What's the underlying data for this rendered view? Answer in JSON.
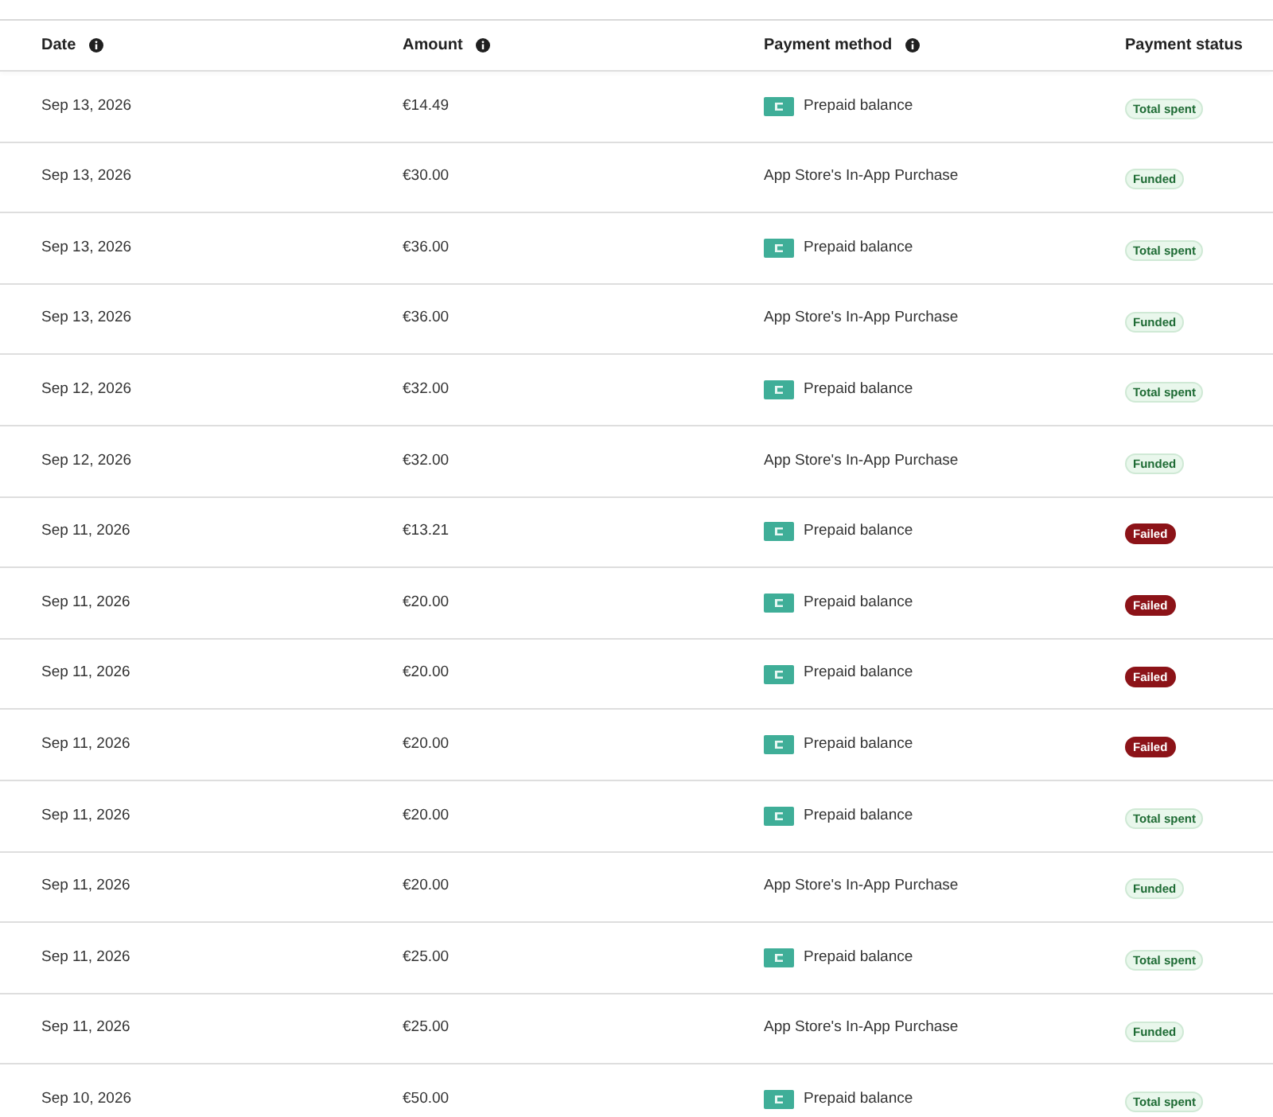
{
  "columns": [
    {
      "label": "Date",
      "info": true
    },
    {
      "label": "Amount",
      "info": true
    },
    {
      "label": "Payment method",
      "info": true
    },
    {
      "label": "Payment status",
      "info": false
    }
  ],
  "rows": [
    {
      "date": "Sep 13, 2026",
      "amount": "€14.49",
      "method": {
        "kind": "prepaid",
        "label": "Prepaid balance"
      },
      "status": {
        "kind": "total_spent",
        "label": "Total spent"
      }
    },
    {
      "date": "Sep 13, 2026",
      "amount": "€30.00",
      "method": {
        "kind": "app_store",
        "label": "App Store's In-App Purchase"
      },
      "status": {
        "kind": "funded",
        "label": "Funded"
      }
    },
    {
      "date": "Sep 13, 2026",
      "amount": "€36.00",
      "method": {
        "kind": "prepaid",
        "label": "Prepaid balance"
      },
      "status": {
        "kind": "total_spent",
        "label": "Total spent"
      }
    },
    {
      "date": "Sep 13, 2026",
      "amount": "€36.00",
      "method": {
        "kind": "app_store",
        "label": "App Store's In-App Purchase"
      },
      "status": {
        "kind": "funded",
        "label": "Funded"
      }
    },
    {
      "date": "Sep 12, 2026",
      "amount": "€32.00",
      "method": {
        "kind": "prepaid",
        "label": "Prepaid balance"
      },
      "status": {
        "kind": "total_spent",
        "label": "Total spent"
      }
    },
    {
      "date": "Sep 12, 2026",
      "amount": "€32.00",
      "method": {
        "kind": "app_store",
        "label": "App Store's In-App Purchase"
      },
      "status": {
        "kind": "funded",
        "label": "Funded"
      }
    },
    {
      "date": "Sep 11, 2026",
      "amount": "€13.21",
      "method": {
        "kind": "prepaid",
        "label": "Prepaid balance"
      },
      "status": {
        "kind": "failed",
        "label": "Failed"
      }
    },
    {
      "date": "Sep 11, 2026",
      "amount": "€20.00",
      "method": {
        "kind": "prepaid",
        "label": "Prepaid balance"
      },
      "status": {
        "kind": "failed",
        "label": "Failed"
      }
    },
    {
      "date": "Sep 11, 2026",
      "amount": "€20.00",
      "method": {
        "kind": "prepaid",
        "label": "Prepaid balance"
      },
      "status": {
        "kind": "failed",
        "label": "Failed"
      }
    },
    {
      "date": "Sep 11, 2026",
      "amount": "€20.00",
      "method": {
        "kind": "prepaid",
        "label": "Prepaid balance"
      },
      "status": {
        "kind": "failed",
        "label": "Failed"
      }
    },
    {
      "date": "Sep 11, 2026",
      "amount": "€20.00",
      "method": {
        "kind": "prepaid",
        "label": "Prepaid balance"
      },
      "status": {
        "kind": "total_spent",
        "label": "Total spent"
      }
    },
    {
      "date": "Sep 11, 2026",
      "amount": "€20.00",
      "method": {
        "kind": "app_store",
        "label": "App Store's In-App Purchase"
      },
      "status": {
        "kind": "funded",
        "label": "Funded"
      }
    },
    {
      "date": "Sep 11, 2026",
      "amount": "€25.00",
      "method": {
        "kind": "prepaid",
        "label": "Prepaid balance"
      },
      "status": {
        "kind": "total_spent",
        "label": "Total spent"
      }
    },
    {
      "date": "Sep 11, 2026",
      "amount": "€25.00",
      "method": {
        "kind": "app_store",
        "label": "App Store's In-App Purchase"
      },
      "status": {
        "kind": "funded",
        "label": "Funded"
      }
    },
    {
      "date": "Sep 10, 2026",
      "amount": "€50.00",
      "method": {
        "kind": "prepaid",
        "label": "Prepaid balance"
      },
      "status": {
        "kind": "total_spent",
        "label": "Total spent"
      }
    }
  ]
}
